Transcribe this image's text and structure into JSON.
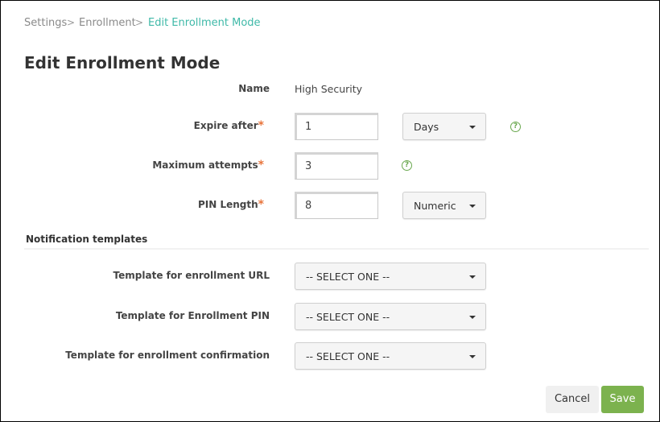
{
  "breadcrumb": {
    "items": [
      "Settings",
      "Enrollment",
      "Edit Enrollment Mode"
    ],
    "separator": ">"
  },
  "page_title": "Edit Enrollment Mode",
  "form": {
    "name_label": "Name",
    "name_value": "High Security",
    "expire_label": "Expire after",
    "expire_value": "1",
    "expire_unit": "Days",
    "max_attempts_label": "Maximum attempts",
    "max_attempts_value": "3",
    "pin_length_label": "PIN Length",
    "pin_length_value": "8",
    "pin_type": "Numeric",
    "required_mark": "*",
    "help_glyph": "?"
  },
  "notifications": {
    "header": "Notification templates",
    "rows": [
      {
        "label": "Template for enrollment URL",
        "value": "-- SELECT ONE --"
      },
      {
        "label": "Template for Enrollment PIN",
        "value": "-- SELECT ONE --"
      },
      {
        "label": "Template for enrollment confirmation",
        "value": "-- SELECT ONE --"
      }
    ]
  },
  "actions": {
    "cancel": "Cancel",
    "save": "Save"
  },
  "colors": {
    "accent": "#3fb9a8",
    "save": "#7cb24e",
    "required": "#e8743b",
    "help": "#6aa84f"
  }
}
